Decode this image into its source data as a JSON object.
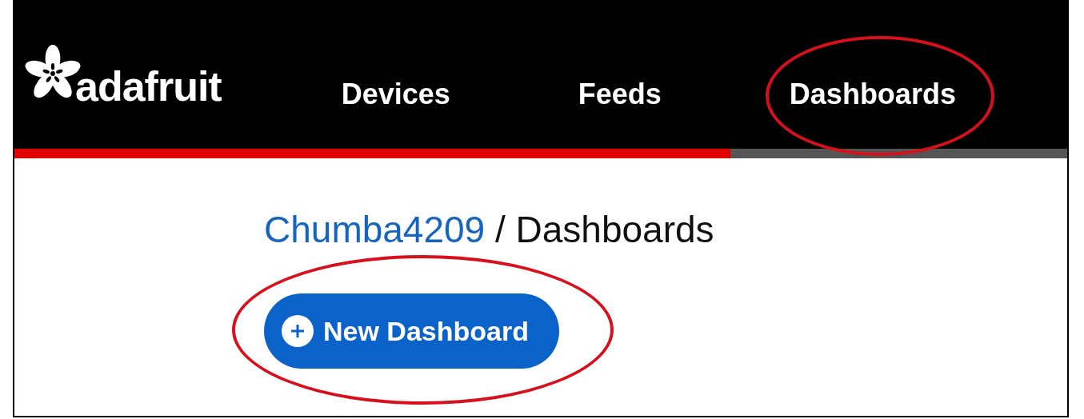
{
  "header": {
    "brand": "adafruit",
    "nav": [
      {
        "label": "Devices",
        "circled": false
      },
      {
        "label": "Feeds",
        "circled": false
      },
      {
        "label": "Dashboards",
        "circled": true
      }
    ],
    "progress": {
      "level": 0.68
    }
  },
  "breadcrumb": {
    "user": "Chumba4209",
    "separator": "/",
    "page": "Dashboards"
  },
  "new_button": {
    "label": "New Dashboard",
    "circled": true
  }
}
